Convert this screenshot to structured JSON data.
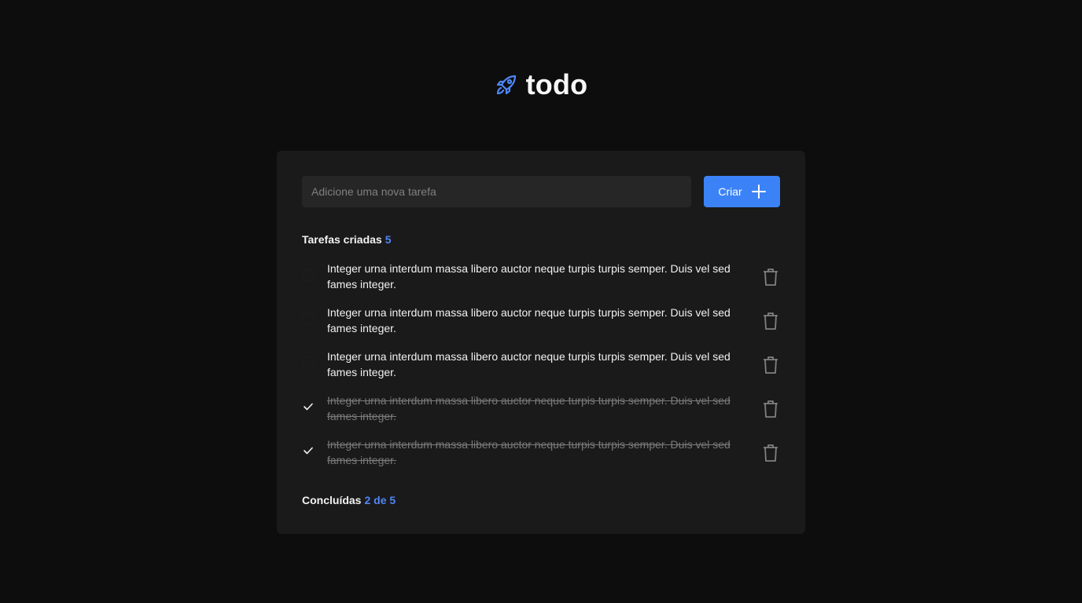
{
  "app": {
    "title": "todo"
  },
  "form": {
    "placeholder": "Adicione uma nova tarefa",
    "create_label": "Criar"
  },
  "counters": {
    "created_label": "Tarefas criadas",
    "created_count": "5",
    "done_label": "Concluídas",
    "done_count": "2 de 5"
  },
  "tasks": [
    {
      "text": "Integer urna interdum massa libero auctor neque turpis turpis semper. Duis vel sed fames integer.",
      "done": false
    },
    {
      "text": "Integer urna interdum massa libero auctor neque turpis turpis semper. Duis vel sed fames integer.",
      "done": false
    },
    {
      "text": "Integer urna interdum massa libero auctor neque turpis turpis semper. Duis vel sed fames integer.",
      "done": false
    },
    {
      "text": "Integer urna interdum massa libero auctor neque turpis turpis semper. Duis vel sed fames integer.",
      "done": true
    },
    {
      "text": "Integer urna interdum massa libero auctor neque turpis turpis semper. Duis vel sed fames integer.",
      "done": true
    }
  ],
  "icons": {
    "logo": "rocket-icon",
    "create": "plus-icon",
    "delete": "trash-icon",
    "check": "check-icon"
  },
  "colors": {
    "accent": "#3b82f6",
    "background": "#0d0d0d",
    "card": "#1a1a1a"
  }
}
